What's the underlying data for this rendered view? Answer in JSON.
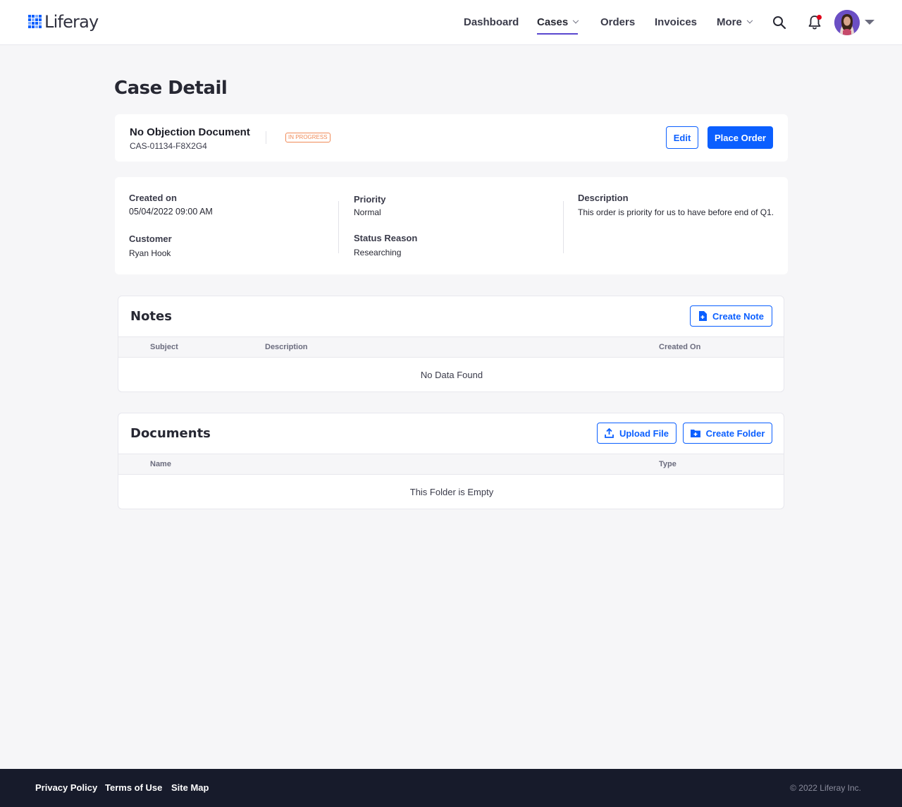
{
  "brand": {
    "name": "Liferay"
  },
  "nav": {
    "items": [
      {
        "label": "Dashboard"
      },
      {
        "label": "Cases"
      },
      {
        "label": "Orders"
      },
      {
        "label": "Invoices"
      },
      {
        "label": "More"
      }
    ],
    "active": "Cases"
  },
  "page": {
    "title": "Case Detail"
  },
  "case": {
    "name": "No Objection Document",
    "code": "CAS-01134-F8X2G4",
    "status": "IN PROGRESS",
    "edit_label": "Edit",
    "place_order_label": "Place Order"
  },
  "details": {
    "created_on_label": "Created on",
    "created_on_value": "05/04/2022 09:00 AM",
    "customer_label": "Customer",
    "customer_value": "Ryan Hook",
    "priority_label": "Priority",
    "priority_value": "Normal",
    "status_reason_label": "Status Reason",
    "status_reason_value": "Researching",
    "description_label": "Description",
    "description_value": "This order is priority for us to have before end of Q1."
  },
  "notes": {
    "title": "Notes",
    "create_label": "Create Note",
    "columns": [
      "Subject",
      "Description",
      "Created On"
    ],
    "empty_text": "No Data Found"
  },
  "documents": {
    "title": "Documents",
    "upload_label": "Upload File",
    "create_folder_label": "Create Folder",
    "columns": [
      "Name",
      "Type"
    ],
    "empty_text": "This Folder is Empty"
  },
  "footer": {
    "links": [
      "Privacy Policy",
      "Terms of Use",
      "Site Map"
    ],
    "copyright": "© 2022 Liferay Inc."
  },
  "colors": {
    "accent": "#0b5fff",
    "nav_underline": "#5a48cf",
    "status": "#f08a57",
    "footer_bg": "#171b2b"
  },
  "icons": {
    "search": "search-icon",
    "bell": "bell-icon",
    "note": "file-icon",
    "upload": "upload-icon",
    "folder": "folder-plus-icon"
  }
}
